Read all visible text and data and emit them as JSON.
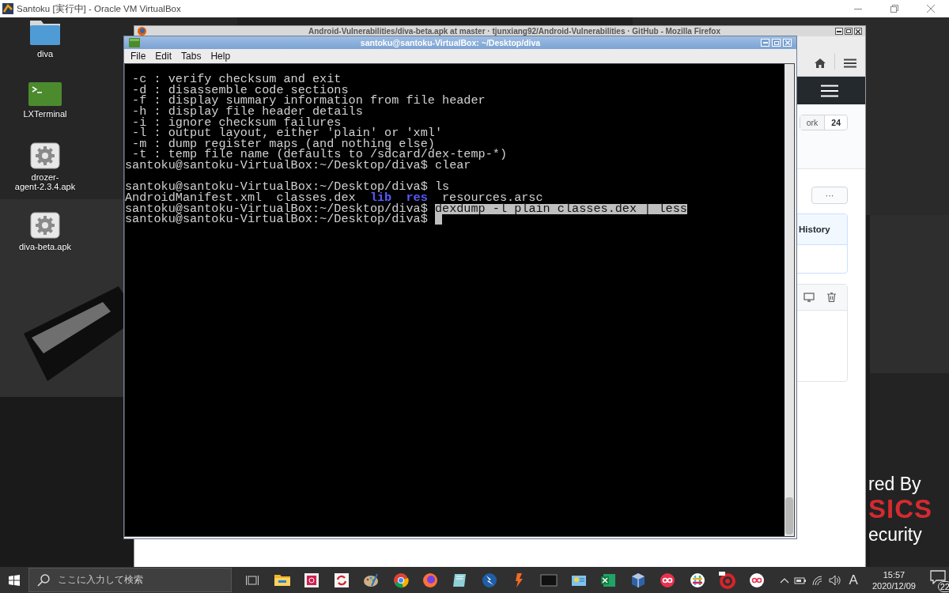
{
  "host_window": {
    "title": "Santoku [実行中] - Oracle VM VirtualBox"
  },
  "desktop_icons": [
    {
      "label": "diva",
      "kind": "folder"
    },
    {
      "label": "LXTerminal",
      "kind": "terminal"
    },
    {
      "label": "drozer-\nagent-2.3.4.apk",
      "kind": "package"
    },
    {
      "label": "diva-beta.apk",
      "kind": "package"
    }
  ],
  "wallpaper_texts": [
    {
      "text": "red By",
      "kind": "plain"
    },
    {
      "text": "SICS",
      "kind": "accent"
    },
    {
      "text": "ecurity",
      "kind": "plain"
    }
  ],
  "browser_window": {
    "title": "Android-Vulnerabilities/diva-beta.apk at master · tjunxiang92/Android-Vulnerabilities · GitHub - Mozilla Firefox",
    "fork_label": "ork",
    "fork_count": "24",
    "more_button": "···",
    "history_link": "History"
  },
  "terminal": {
    "title": "santoku@santoku-VirtualBox: ~/Desktop/diva",
    "menu": [
      "File",
      "Edit",
      "Tabs",
      "Help"
    ],
    "lines": [
      {
        "kind": "output",
        "cursor": false,
        "segments": [
          {
            "text": " -c : verify checksum and exit",
            "kind": "plain"
          }
        ]
      },
      {
        "kind": "output",
        "cursor": false,
        "segments": [
          {
            "text": " -d : disassemble code sections",
            "kind": "plain"
          }
        ]
      },
      {
        "kind": "output",
        "cursor": false,
        "segments": [
          {
            "text": " -f : display summary information from file header",
            "kind": "plain"
          }
        ]
      },
      {
        "kind": "output",
        "cursor": false,
        "segments": [
          {
            "text": " -h : display file header details",
            "kind": "plain"
          }
        ]
      },
      {
        "kind": "output",
        "cursor": false,
        "segments": [
          {
            "text": " -i : ignore checksum failures",
            "kind": "plain"
          }
        ]
      },
      {
        "kind": "output",
        "cursor": false,
        "segments": [
          {
            "text": " -l : output layout, either 'plain' or 'xml'",
            "kind": "plain"
          }
        ]
      },
      {
        "kind": "output",
        "cursor": false,
        "segments": [
          {
            "text": " -m : dump register maps (and nothing else)",
            "kind": "plain"
          }
        ]
      },
      {
        "kind": "output",
        "cursor": false,
        "segments": [
          {
            "text": " -t : temp file name (defaults to /sdcard/dex-temp-*)",
            "kind": "plain"
          }
        ]
      },
      {
        "kind": "output",
        "cursor": false,
        "segments": [
          {
            "text": "santoku@santoku-VirtualBox:~/Desktop/diva$ clear",
            "kind": "plain"
          }
        ]
      },
      {
        "kind": "blank",
        "cursor": false
      },
      {
        "kind": "output",
        "cursor": false,
        "segments": [
          {
            "text": "santoku@santoku-VirtualBox:~/Desktop/diva$ ls",
            "kind": "plain"
          }
        ]
      },
      {
        "kind": "listing",
        "cursor": false,
        "segments": [
          {
            "text": "AndroidManifest.xml",
            "kind": "plain"
          },
          {
            "text": "classes.dex",
            "kind": "plain"
          },
          {
            "text": "lib",
            "kind": "dir"
          },
          {
            "text": "res",
            "kind": "dir"
          },
          {
            "text": "resources.arsc",
            "kind": "plain"
          }
        ]
      },
      {
        "kind": "output",
        "cursor": false,
        "segments": [
          {
            "text": "santoku@santoku-VirtualBox:~/Desktop/diva$ ",
            "kind": "plain"
          },
          {
            "text": "dexdump -l plain classes.dex | less",
            "kind": "selection"
          }
        ]
      },
      {
        "kind": "output",
        "cursor": true,
        "segments": [
          {
            "text": "santoku@santoku-VirtualBox:~/Desktop/diva$ ",
            "kind": "plain"
          }
        ]
      }
    ]
  },
  "taskbar": {
    "search": {
      "placeholder": "ここに入力して検索"
    },
    "input_indicator": "A",
    "clock": {
      "time": "15:57",
      "date": "2020/12/09"
    },
    "notifications": "22"
  }
}
